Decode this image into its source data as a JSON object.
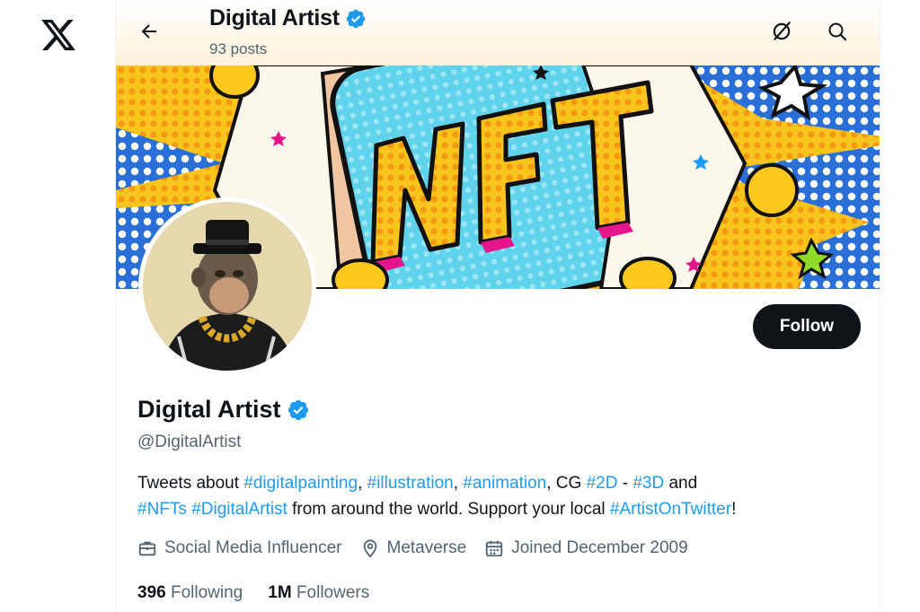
{
  "app": {
    "logo_icon": "x-logo-icon"
  },
  "header": {
    "title": "Digital Artist",
    "posts_count": "93 posts",
    "back_icon": "arrow-left-icon",
    "grok_icon": "grok-icon",
    "search_icon": "search-icon"
  },
  "banner": {
    "text": "NFT"
  },
  "profile": {
    "name": "Digital Artist",
    "verified_icon": "verified-badge-icon",
    "handle": "@DigitalArtist",
    "follow_label": "Follow",
    "bio": {
      "t1": "Tweets about ",
      "h1": "#digitalpainting",
      "t2": ", ",
      "h2": "#illustration",
      "t3": ", ",
      "h3": "#animation",
      "t4": ", CG ",
      "h4": "#2D",
      "t5": " - ",
      "h5": "#3D",
      "t6": " and ",
      "h6": "#NFTs",
      "t7": " ",
      "h7": "#DigitalArtist",
      "t8": " from around the world. Support your local ",
      "h8": "#ArtistOnTwitter",
      "t9": "!"
    },
    "meta": {
      "category": "Social Media Influencer",
      "category_icon": "briefcase-icon",
      "location": "Metaverse",
      "location_icon": "location-pin-icon",
      "joined": "Joined December 2009",
      "joined_icon": "calendar-icon"
    },
    "stats": {
      "following_count": "396",
      "following_label": "Following",
      "followers_count": "1M",
      "followers_label": "Followers"
    }
  },
  "colors": {
    "accent": "#1d9bf0",
    "text_primary": "#0f1419",
    "text_secondary": "#536471",
    "button_bg": "#0f1419"
  }
}
